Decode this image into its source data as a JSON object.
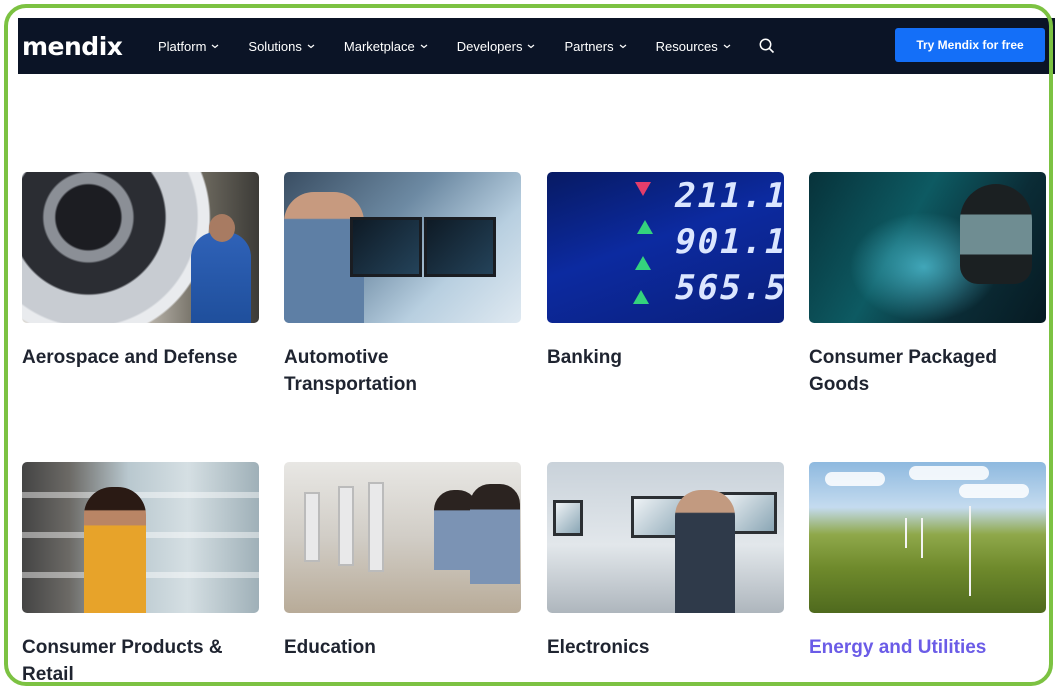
{
  "brand": {
    "logo_text": "mendix",
    "accent": "#146ff8",
    "nav_bg": "#0b1426",
    "frame_color": "#7cc242"
  },
  "nav": {
    "items": [
      {
        "label": "Platform"
      },
      {
        "label": "Solutions"
      },
      {
        "label": "Marketplace"
      },
      {
        "label": "Developers"
      },
      {
        "label": "Partners"
      },
      {
        "label": "Resources"
      }
    ],
    "search_icon": "search-icon",
    "cta_label": "Try Mendix for free"
  },
  "industries": [
    {
      "label": "Aerospace and Defense"
    },
    {
      "label": "Automotive Transportation"
    },
    {
      "label": "Banking",
      "image_numbers": [
        "211.1",
        "901.1",
        "565.5"
      ]
    },
    {
      "label": "Consumer Packaged Goods"
    },
    {
      "label": "Consumer Products & Retail"
    },
    {
      "label": "Education"
    },
    {
      "label": "Electronics"
    },
    {
      "label": "Energy and Utilities",
      "hover_color": "#6b5ce7"
    }
  ]
}
